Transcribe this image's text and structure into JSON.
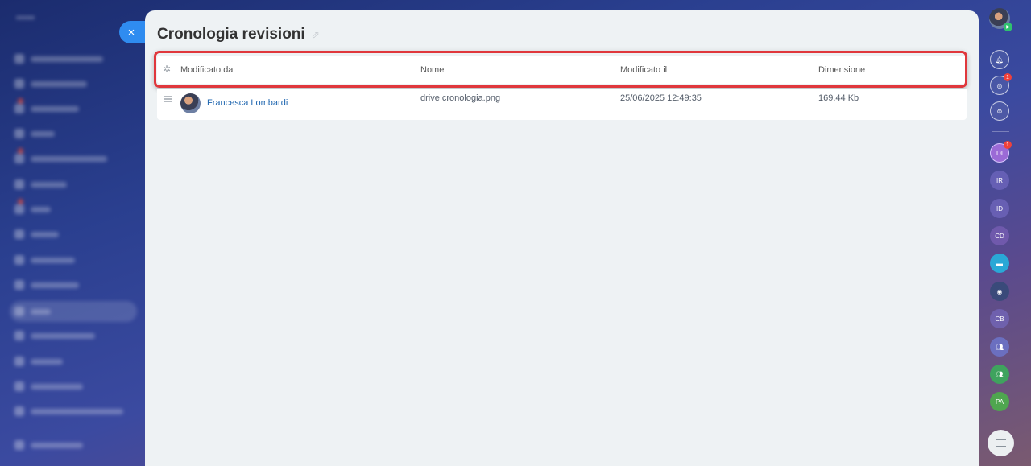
{
  "panel": {
    "title": "Cronologia revisioni",
    "close_label": "×",
    "pin_icon": "pin-icon"
  },
  "table": {
    "columns": [
      "Modificato da",
      "Nome",
      "Modificato il",
      "Dimensione"
    ],
    "rows": [
      {
        "modified_by": "Francesca Lombardi",
        "name": "drive cronologia.png",
        "modified_on": "25/06/2025 12:49:35",
        "size": "169.44 Kb"
      }
    ]
  },
  "right_bar": {
    "notifications_badge": "1",
    "chat_badge": "1",
    "contacts": [
      {
        "initials": "DI",
        "badge": "1"
      },
      {
        "initials": "IR"
      },
      {
        "initials": "ID"
      },
      {
        "initials": "CD"
      },
      {
        "initials": "CB"
      },
      {
        "initials": "PA"
      }
    ]
  },
  "colors": {
    "accent": "#2f8cf0",
    "highlight": "#e0373c",
    "link": "#2067b0",
    "panel_bg": "#eef2f4"
  }
}
